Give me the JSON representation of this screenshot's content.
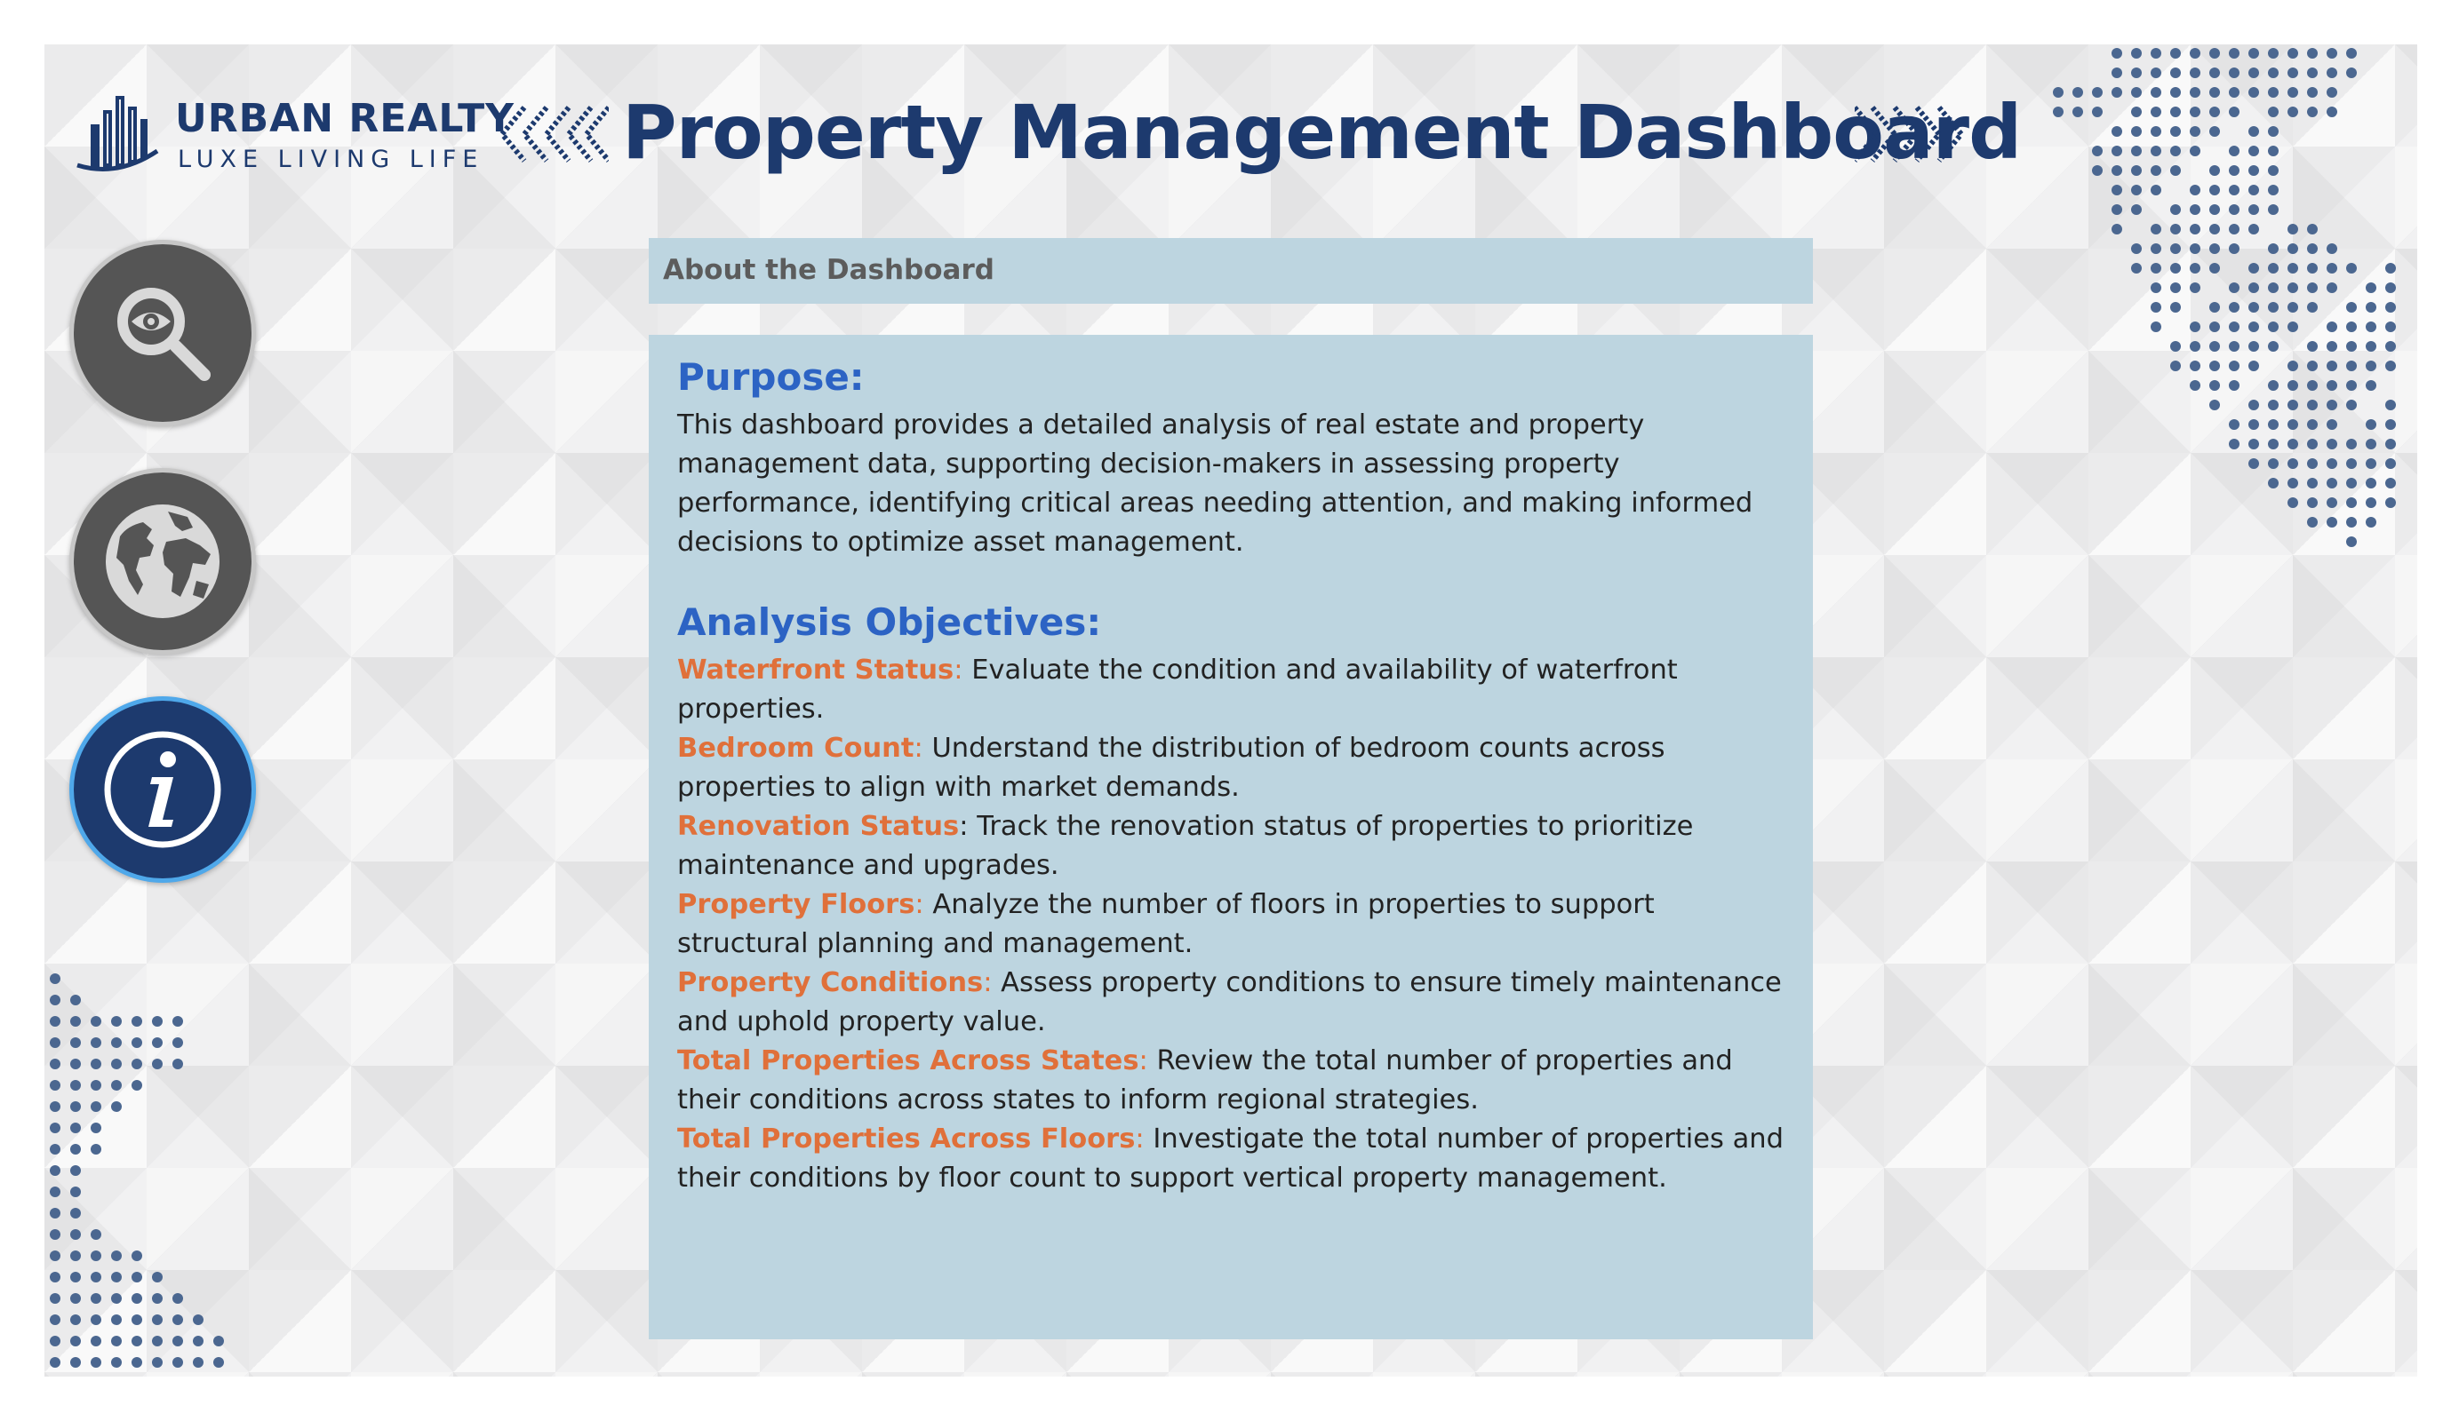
{
  "brand": {
    "name": "URBAN REALTY",
    "tagline": "LUXE LIVING LIFE"
  },
  "header": {
    "title": "Property Management Dashboard"
  },
  "nav": {
    "items": [
      {
        "name": "analysis",
        "icon": "magnifier-eye-icon",
        "active": false
      },
      {
        "name": "map",
        "icon": "globe-icon",
        "active": false
      },
      {
        "name": "about",
        "icon": "info-icon",
        "active": true
      }
    ]
  },
  "about": {
    "header": "About the Dashboard",
    "purpose_heading": "Purpose:",
    "purpose_text": "This dashboard provides a detailed analysis of real estate and property management data, supporting decision-makers in assessing property performance, identifying critical areas needing attention, and making informed decisions to optimize asset management.",
    "objectives_heading": "Analysis Objectives:",
    "objectives": [
      {
        "title": "Waterfront Status",
        "text": "Evaluate the condition and availability of waterfront properties."
      },
      {
        "title": "Bedroom Count",
        "text": "Understand the distribution of bedroom counts across properties to align with market demands."
      },
      {
        "title": "Renovation Status",
        "text": "Track the renovation status of properties to prioritize maintenance and upgrades."
      },
      {
        "title": "Property Floors",
        "text": "Analyze the number of floors in properties to support structural planning and management."
      },
      {
        "title": "Property Conditions",
        "text": "Assess property conditions to ensure timely maintenance and uphold property value."
      },
      {
        "title": "Total Properties Across States",
        "text": "Review the total number of properties and their conditions across states to inform regional strategies."
      },
      {
        "title": "Total Properties Across Floors",
        "text": "Investigate the total number of properties and their conditions by floor count to support vertical property management."
      }
    ]
  },
  "colors": {
    "brand_navy": "#1d3a6e",
    "panel_blue": "#bdd5e0",
    "heading_blue": "#2c63c4",
    "accent_orange": "#e0703a",
    "nav_gray": "#555555",
    "active_ring": "#4fa8ea"
  }
}
